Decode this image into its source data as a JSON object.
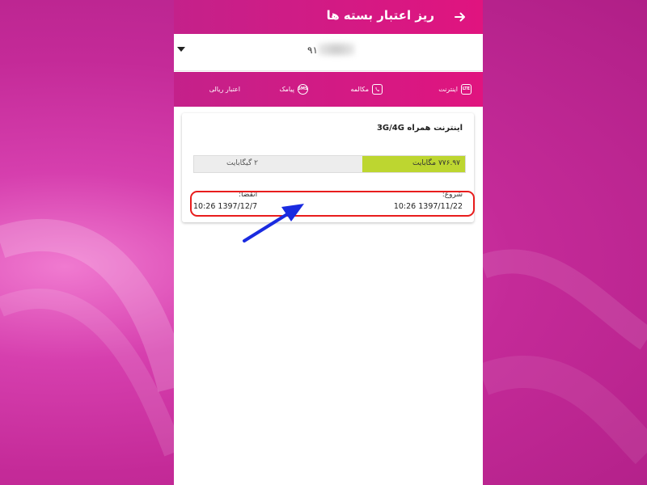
{
  "header": {
    "title": "ریز اعتبار بسته ها",
    "back_icon": "arrow-right-icon"
  },
  "selector": {
    "number_visible": "۹۱",
    "caret_icon": "caret-down-icon"
  },
  "tabs": [
    {
      "label": "اینترنت",
      "icon": "lte-icon",
      "icon_text": "LTE"
    },
    {
      "label": "مکالمه",
      "icon": "phone-icon",
      "icon_text": ""
    },
    {
      "label": "پیامک",
      "icon": "sms-icon",
      "icon_text": "SMS"
    },
    {
      "label": "اعتبار ریالی",
      "icon": "",
      "icon_text": ""
    }
  ],
  "package": {
    "title": "اینترنت همراه 3G/4G",
    "used": "۷۷۶.۹۷ مگابایت",
    "total": "۲ گیگابایت",
    "used_fraction": 0.38,
    "start_label": "شروع:",
    "start_value": "10:26 1397/11/22",
    "end_label": "انقضا:",
    "end_value": "10:26 1397/12/7"
  },
  "colors": {
    "brand": "#e0147f",
    "usage_fill": "#bdd630",
    "highlight": "#e81d1d",
    "arrow": "#1a2be0"
  }
}
